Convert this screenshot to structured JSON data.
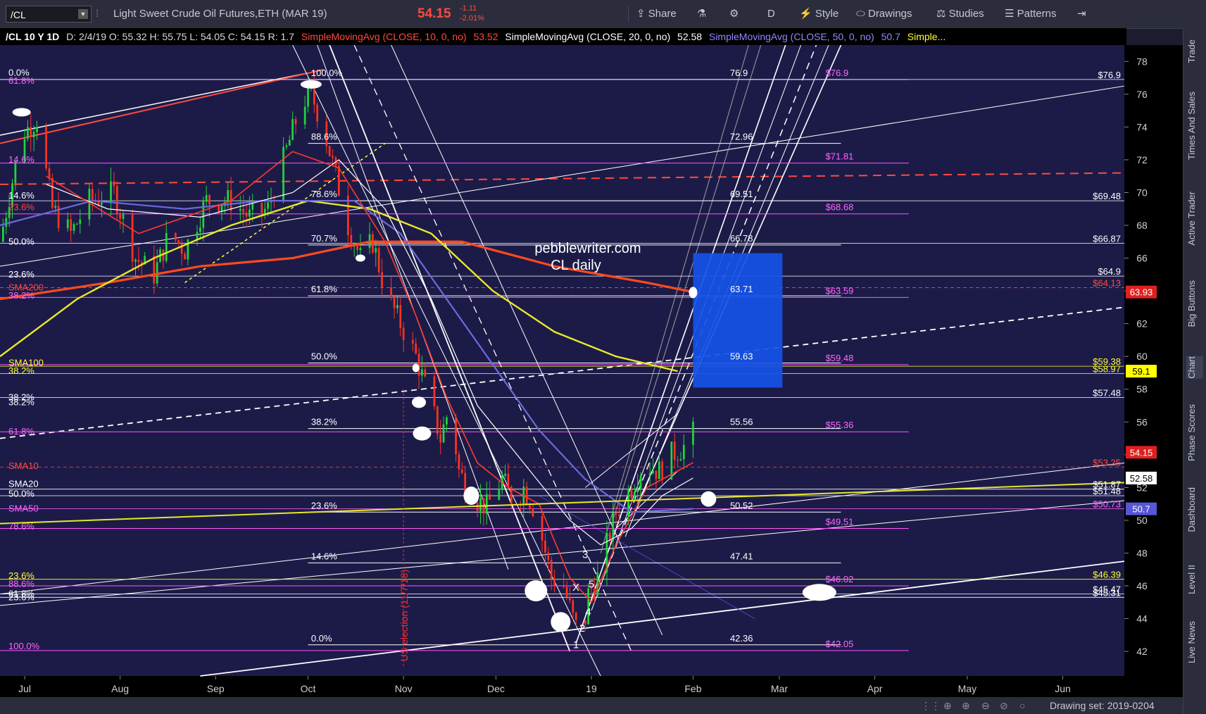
{
  "toolbar": {
    "symbol": "/CL",
    "description": "Light Sweet Crude Oil Futures,ETH (MAR 19)",
    "last_price": "54.15",
    "change": "-1.11",
    "change_pct": "-2.01%",
    "share": "Share",
    "timeframe": "D",
    "style": "Style",
    "drawings": "Drawings",
    "studies": "Studies",
    "patterns": "Patterns",
    "colors": {
      "up": "#ff4a3d",
      "bg": "#2b2d3d"
    },
    "icons": [
      "share-icon",
      "flask-icon",
      "gear-icon",
      "style-icon",
      "drawings-icon",
      "studies-icon",
      "patterns-icon",
      "collapse-icon"
    ]
  },
  "studybar": {
    "symbol_info": "/CL 10 Y 1D",
    "ohlc": "D: 2/4/19   O: 55.32   H: 55.75   L: 54.05   C: 54.15   R: 1.7",
    "sma10_label": "SimpleMovingAvg (CLOSE, 10, 0, no)",
    "sma10_value": "53.52",
    "sma20_label": "SimpleMovingAvg (CLOSE, 20, 0, no)",
    "sma20_value": "52.58",
    "sma50_label": "SimpleMovingAvg (CLOSE, 50, 0, no)",
    "sma50_value": "50.7",
    "more": "Simple..."
  },
  "right_rail": [
    "Trade",
    "Times And Sales",
    "Active Trader",
    "Big Buttons",
    "Chart",
    "Phase Scores",
    "Dashboard",
    "Level II",
    "Live News"
  ],
  "bottom": {
    "drawing_set": "Drawing set: 2019-0204"
  },
  "chart_data": {
    "type": "candlestick",
    "title": "pebblewriter.com CL daily",
    "y_range": [
      40.5,
      79
    ],
    "y_ticks": [
      42,
      44,
      46,
      48,
      50,
      52,
      54,
      56,
      58,
      60,
      62,
      64,
      66,
      68,
      70,
      72,
      74,
      76,
      78
    ],
    "x_range_days": [
      -225,
      140
    ],
    "x_labels": [
      {
        "label": "Jul",
        "day": -217
      },
      {
        "label": "Aug",
        "day": -186
      },
      {
        "label": "Sep",
        "day": -155
      },
      {
        "label": "Oct",
        "day": -125
      },
      {
        "label": "Nov",
        "day": -94
      },
      {
        "label": "Dec",
        "day": -64
      },
      {
        "label": "19",
        "day": -33
      },
      {
        "label": "Feb",
        "day": 0
      },
      {
        "label": "Mar",
        "day": 28
      },
      {
        "label": "Apr",
        "day": 59
      },
      {
        "label": "May",
        "day": 89
      },
      {
        "label": "Jun",
        "day": 120
      }
    ],
    "price_path": [
      [
        -225,
        67.0
      ],
      [
        -218,
        73.5
      ],
      [
        -213,
        74.5
      ],
      [
        -208,
        69.0
      ],
      [
        -202,
        67.5
      ],
      [
        -196,
        69.5
      ],
      [
        -188,
        70.0
      ],
      [
        -181,
        66.0
      ],
      [
        -175,
        65.0
      ],
      [
        -170,
        67.5
      ],
      [
        -165,
        66.5
      ],
      [
        -158,
        69.5
      ],
      [
        -150,
        69.5
      ],
      [
        -144,
        68.5
      ],
      [
        -138,
        69.0
      ],
      [
        -133,
        72.0
      ],
      [
        -127,
        75.5
      ],
      [
        -124,
        76.0
      ],
      [
        -120,
        74.0
      ],
      [
        -116,
        71.0
      ],
      [
        -112,
        68.0
      ],
      [
        -108,
        66.0
      ],
      [
        -104,
        67.0
      ],
      [
        -100,
        64.0
      ],
      [
        -95,
        62.0
      ],
      [
        -90,
        60.0
      ],
      [
        -85,
        57.0
      ],
      [
        -82,
        55.0
      ],
      [
        -79,
        57.0
      ],
      [
        -76,
        53.0
      ],
      [
        -72,
        51.5
      ],
      [
        -67,
        50.8
      ],
      [
        -62,
        52.5
      ],
      [
        -58,
        51.0
      ],
      [
        -55,
        52.0
      ],
      [
        -51,
        50.5
      ],
      [
        -46,
        46.5
      ],
      [
        -42,
        46.0
      ],
      [
        -39,
        44.0
      ],
      [
        -36,
        42.5
      ],
      [
        -34,
        45.5
      ],
      [
        -31,
        46.5
      ],
      [
        -28,
        48.5
      ],
      [
        -25,
        50.5
      ],
      [
        -20,
        52.0
      ],
      [
        -16,
        53.5
      ],
      [
        -11,
        53.0
      ],
      [
        -7,
        54.0
      ],
      [
        -3,
        54.5
      ],
      [
        0,
        55.3
      ],
      [
        1,
        54.15
      ]
    ],
    "sma10": [
      [
        -210,
        71
      ],
      [
        -180,
        67.5
      ],
      [
        -150,
        69.5
      ],
      [
        -130,
        72.5
      ],
      [
        -115,
        71.5
      ],
      [
        -100,
        67
      ],
      [
        -90,
        62.5
      ],
      [
        -80,
        57.5
      ],
      [
        -70,
        53.5
      ],
      [
        -60,
        52.0
      ],
      [
        -50,
        51.0
      ],
      [
        -40,
        46.5
      ],
      [
        -33,
        45.0
      ],
      [
        -25,
        48.5
      ],
      [
        -15,
        52.0
      ],
      [
        0,
        53.52
      ]
    ],
    "sma20": [
      [
        -210,
        70.5
      ],
      [
        -190,
        69.0
      ],
      [
        -160,
        68.5
      ],
      [
        -130,
        70.0
      ],
      [
        -115,
        72.0
      ],
      [
        -100,
        69.0
      ],
      [
        -85,
        63.5
      ],
      [
        -70,
        57.0
      ],
      [
        -55,
        53.5
      ],
      [
        -40,
        50.0
      ],
      [
        -30,
        48.5
      ],
      [
        -20,
        49.5
      ],
      [
        -10,
        51.5
      ],
      [
        0,
        52.58
      ]
    ],
    "sma50": [
      [
        -225,
        68
      ],
      [
        -195,
        69.5
      ],
      [
        -165,
        69.0
      ],
      [
        -140,
        69.5
      ],
      [
        -110,
        69.5
      ],
      [
        -95,
        67.5
      ],
      [
        -80,
        63.5
      ],
      [
        -65,
        59.5
      ],
      [
        -50,
        55.5
      ],
      [
        -35,
        52.5
      ],
      [
        -20,
        50.5
      ],
      [
        0,
        50.7
      ]
    ],
    "sma100": [
      [
        -225,
        60
      ],
      [
        -200,
        63.5
      ],
      [
        -175,
        66.0
      ],
      [
        -150,
        68.0
      ],
      [
        -125,
        69.5
      ],
      [
        -105,
        69.0
      ],
      [
        -85,
        67.5
      ],
      [
        -65,
        64.0
      ],
      [
        -45,
        61.5
      ],
      [
        -25,
        60.0
      ],
      [
        -5,
        59.1
      ]
    ],
    "sma200": [
      [
        -225,
        63.5
      ],
      [
        -190,
        64.5
      ],
      [
        -160,
        65.5
      ],
      [
        -130,
        66.0
      ],
      [
        -105,
        67.0
      ],
      [
        -75,
        67.0
      ],
      [
        -45,
        65.5
      ],
      [
        -15,
        64.5
      ],
      [
        0,
        63.93
      ]
    ],
    "fib_levels": [
      {
        "pct": "100.0%",
        "value": "76.9",
        "price": 76.9
      },
      {
        "pct": "88.6%",
        "value": "72.96",
        "price": 73.0
      },
      {
        "pct": "78.6%",
        "value": "69.51",
        "price": 69.5
      },
      {
        "pct": "70.7%",
        "value": "66.78",
        "price": 66.8
      },
      {
        "pct": "61.8%",
        "value": "63.71",
        "price": 63.7
      },
      {
        "pct": "50.0%",
        "value": "59.63",
        "price": 59.6
      },
      {
        "pct": "38.2%",
        "value": "55.56",
        "price": 55.6
      },
      {
        "pct": "23.6%",
        "value": "50.52",
        "price": 50.5
      },
      {
        "pct": "14.6%",
        "value": "47.41",
        "price": 47.4
      },
      {
        "pct": "0.0%",
        "value": "42.36",
        "price": 42.4
      }
    ],
    "magenta_levels": [
      {
        "value": "$76.9",
        "price": 76.9
      },
      {
        "value": "$71.81",
        "price": 71.8
      },
      {
        "value": "$68.68",
        "price": 68.7
      },
      {
        "value": "$63.59",
        "price": 63.6
      },
      {
        "value": "$59.48",
        "price": 59.5
      },
      {
        "value": "$55.36",
        "price": 55.4
      },
      {
        "value": "$49.51",
        "price": 49.5
      },
      {
        "value": "$46.02",
        "price": 46.0
      },
      {
        "value": "$42.05",
        "price": 42.05
      }
    ],
    "right_labels": [
      {
        "text": "$76.9",
        "price": 76.9,
        "color": "#ffffff"
      },
      {
        "text": "$69.48",
        "price": 69.5,
        "color": "#ffffff"
      },
      {
        "text": "$66.87",
        "price": 66.9,
        "color": "#ffffff"
      },
      {
        "text": "$64.9",
        "price": 64.9,
        "color": "#ffffff"
      },
      {
        "text": "$64.13",
        "price": 64.2,
        "color": "#ff4a3d"
      },
      {
        "text": "$59.38",
        "price": 59.4,
        "color": "#ffff33"
      },
      {
        "text": "$58.97",
        "price": 58.95,
        "color": "#ffff33"
      },
      {
        "text": "$57.48",
        "price": 57.5,
        "color": "#ffffff"
      },
      {
        "text": "$53.25",
        "price": 53.25,
        "color": "#ff4a3d"
      },
      {
        "text": "$51.87",
        "price": 51.9,
        "color": "#ffffff"
      },
      {
        "text": "$51.48",
        "price": 51.5,
        "color": "#ffffff"
      },
      {
        "text": "$50.73",
        "price": 50.7,
        "color": "#ff66ff"
      },
      {
        "text": "$46.39",
        "price": 46.4,
        "color": "#ffff33"
      },
      {
        "text": "$45.47",
        "price": 45.5,
        "color": "#ffffff"
      },
      {
        "text": "$45.31",
        "price": 45.3,
        "color": "#ffffff"
      }
    ],
    "left_labels": [
      {
        "text": "0.0%",
        "price": 77.3,
        "color": "#ffffff"
      },
      {
        "text": "61.8%",
        "price": 76.8,
        "color": "#ff66ff"
      },
      {
        "text": "14.6%",
        "price": 72.0,
        "color": "#ff66ff"
      },
      {
        "text": "14.6%",
        "price": 69.8,
        "color": "#ffffff"
      },
      {
        "text": "23.6%",
        "price": 69.1,
        "color": "#ff4a3d"
      },
      {
        "text": "50.0%",
        "price": 67.0,
        "color": "#ffffff"
      },
      {
        "text": "23.6%",
        "price": 65.0,
        "color": "#ffffff"
      },
      {
        "text": "SMA200",
        "price": 64.2,
        "color": "#ff4a3d"
      },
      {
        "text": "38.2%",
        "price": 63.7,
        "color": "#ff66ff"
      },
      {
        "text": "SMA100",
        "price": 59.6,
        "color": "#ffff33"
      },
      {
        "text": "38.2%",
        "price": 59.1,
        "color": "#ffff33"
      },
      {
        "text": "38.2%",
        "price": 57.5,
        "color": "#ffffff"
      },
      {
        "text": "38.2%",
        "price": 57.2,
        "color": "#ffffff"
      },
      {
        "text": "61.8%",
        "price": 55.4,
        "color": "#ff66ff"
      },
      {
        "text": "SMA10",
        "price": 53.3,
        "color": "#ff4a3d"
      },
      {
        "text": "SMA20",
        "price": 52.2,
        "color": "#ffffff"
      },
      {
        "text": "50.0%",
        "price": 51.6,
        "color": "#ffffff"
      },
      {
        "text": "SMA50",
        "price": 50.7,
        "color": "#ff66ff"
      },
      {
        "text": "78.6%",
        "price": 49.6,
        "color": "#ff66ff"
      },
      {
        "text": "23.6%",
        "price": 46.6,
        "color": "#ffff33"
      },
      {
        "text": "88.6%",
        "price": 46.1,
        "color": "#ff66ff"
      },
      {
        "text": "61.8%",
        "price": 45.5,
        "color": "#ffffff"
      },
      {
        "text": "23.6%",
        "price": 45.3,
        "color": "#ffffff"
      },
      {
        "text": "100.0%",
        "price": 42.3,
        "color": "#ff66ff"
      }
    ],
    "price_badges": [
      {
        "text": "63.93",
        "price": 63.93,
        "bg": "#e02020",
        "fg": "#ffffff"
      },
      {
        "text": "59.1",
        "price": 59.1,
        "bg": "#ffff00",
        "fg": "#000000"
      },
      {
        "text": "54.15",
        "price": 54.15,
        "bg": "#e02020",
        "fg": "#ffffff"
      },
      {
        "text": "52.58",
        "price": 52.58,
        "bg": "#ffffff",
        "fg": "#000000"
      },
      {
        "text": "50.7",
        "price": 50.7,
        "bg": "#5656d6",
        "fg": "#ffffff"
      }
    ],
    "annotations": {
      "election": "US election (11/7/18)",
      "wave_labels": [
        "3",
        "X",
        "5",
        "4",
        "2",
        "1"
      ]
    }
  }
}
